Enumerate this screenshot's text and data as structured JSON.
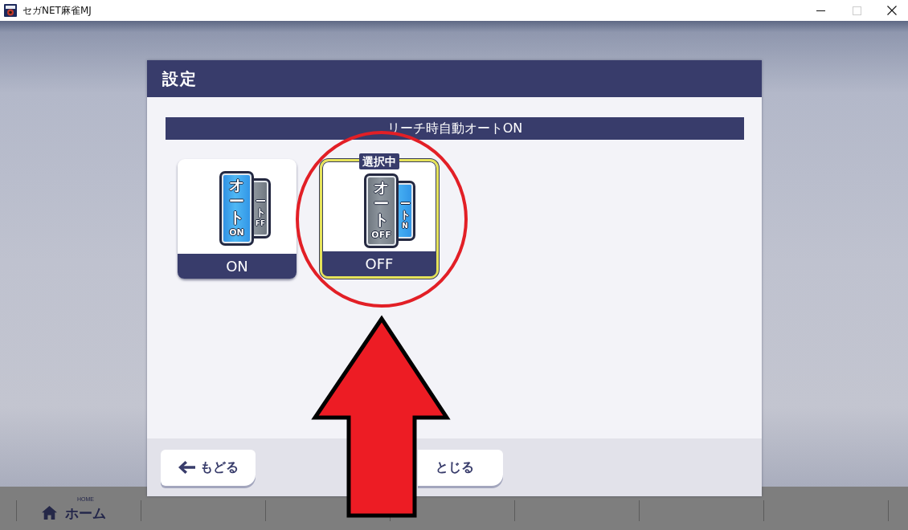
{
  "window": {
    "title": "セガNET麻雀MJ",
    "controls": [
      {
        "kind": "minimize",
        "disabled": false
      },
      {
        "kind": "maximize",
        "disabled": true
      },
      {
        "kind": "close",
        "disabled": false
      }
    ]
  },
  "nav_bar": {
    "items": [
      {
        "kind": "home",
        "caption": "HOME",
        "label": "ホーム"
      }
    ]
  },
  "dialog": {
    "title": "設定",
    "section": {
      "heading": "リーチ時自動オートON",
      "selected_badge": "選択中",
      "options": [
        {
          "label": "ON",
          "selected": false,
          "tile": {
            "text": "オート",
            "state": "ON",
            "on": true
          },
          "back_tile": {
            "text": "ート",
            "state": "FF",
            "on": false
          }
        },
        {
          "label": "OFF",
          "selected": true,
          "tile": {
            "text": "オート",
            "state": "OFF",
            "on": false
          },
          "back_tile": {
            "text": "ート",
            "state": "N",
            "on": true
          }
        }
      ]
    },
    "buttons": [
      {
        "kind": "back",
        "label": "もどる"
      },
      {
        "kind": "close",
        "label": "とじる"
      }
    ]
  },
  "annotations": {
    "highlight_circle": true,
    "pointer_arrow": true
  }
}
